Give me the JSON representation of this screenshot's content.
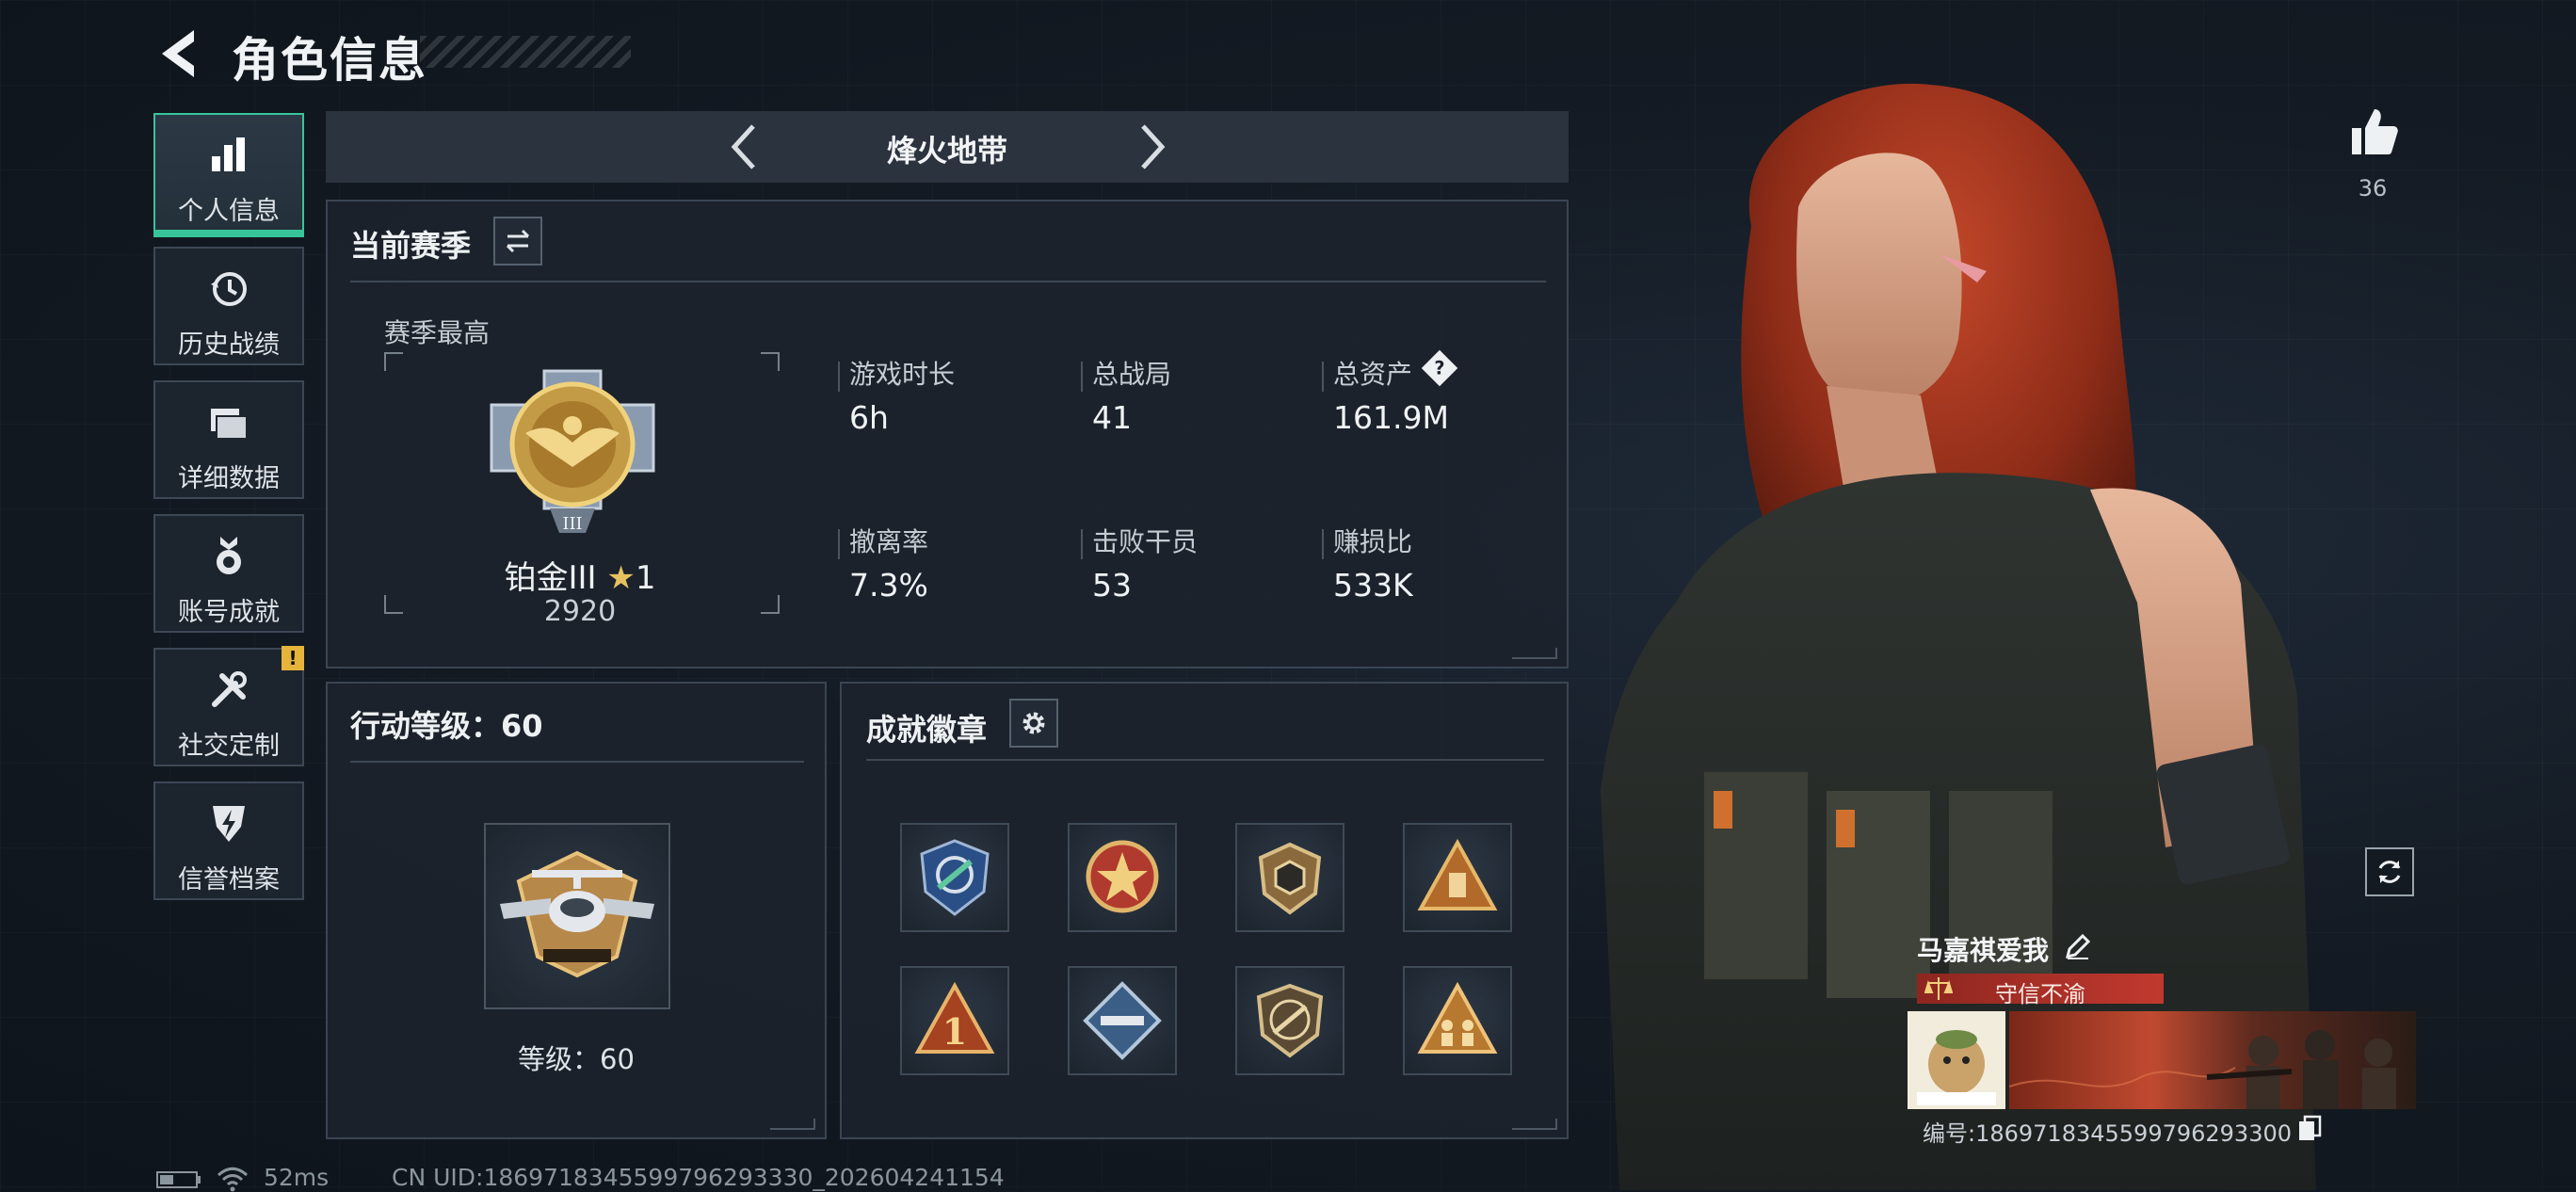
{
  "header": {
    "title": "角色信息"
  },
  "side_nav": [
    {
      "label": "个人信息",
      "icon": "bar-chart-icon",
      "active": true
    },
    {
      "label": "历史战绩",
      "icon": "history-clock-icon"
    },
    {
      "label": "详细数据",
      "icon": "folder-data-icon"
    },
    {
      "label": "账号成就",
      "icon": "medal-icon"
    },
    {
      "label": "社交定制",
      "icon": "tools-icon",
      "badge": "!"
    },
    {
      "label": "信誉档案",
      "icon": "lightning-shield-icon"
    }
  ],
  "mode": {
    "name": "烽火地带"
  },
  "season": {
    "title": "当前赛季",
    "best_label": "赛季最高",
    "rank_name": "铂金III",
    "stars": "1",
    "score": "2920",
    "stats": [
      {
        "label": "游戏时长",
        "value": "6h"
      },
      {
        "label": "总战局",
        "value": "41"
      },
      {
        "label": "总资产",
        "value": "161.9M",
        "help": "?"
      },
      {
        "label": "撤离率",
        "value": "7.3%"
      },
      {
        "label": "击败干员",
        "value": "53"
      },
      {
        "label": "赚损比",
        "value": "533K"
      }
    ]
  },
  "action_level": {
    "title": "行动等级：60",
    "level_text": "等级：60"
  },
  "achievements": {
    "title": "成就徽章"
  },
  "profile": {
    "likes": "36",
    "player_name": "马嘉祺爱我",
    "honor_tag": "守信不渝",
    "id_text": "编号:1869718345599796293300"
  },
  "status": {
    "latency": "52ms",
    "uid_text": "CN UID:1869718345599796293330_202604241154"
  },
  "colors": {
    "accent": "#38c49a",
    "honor": "#b8362f",
    "alert": "#e6b43a"
  }
}
